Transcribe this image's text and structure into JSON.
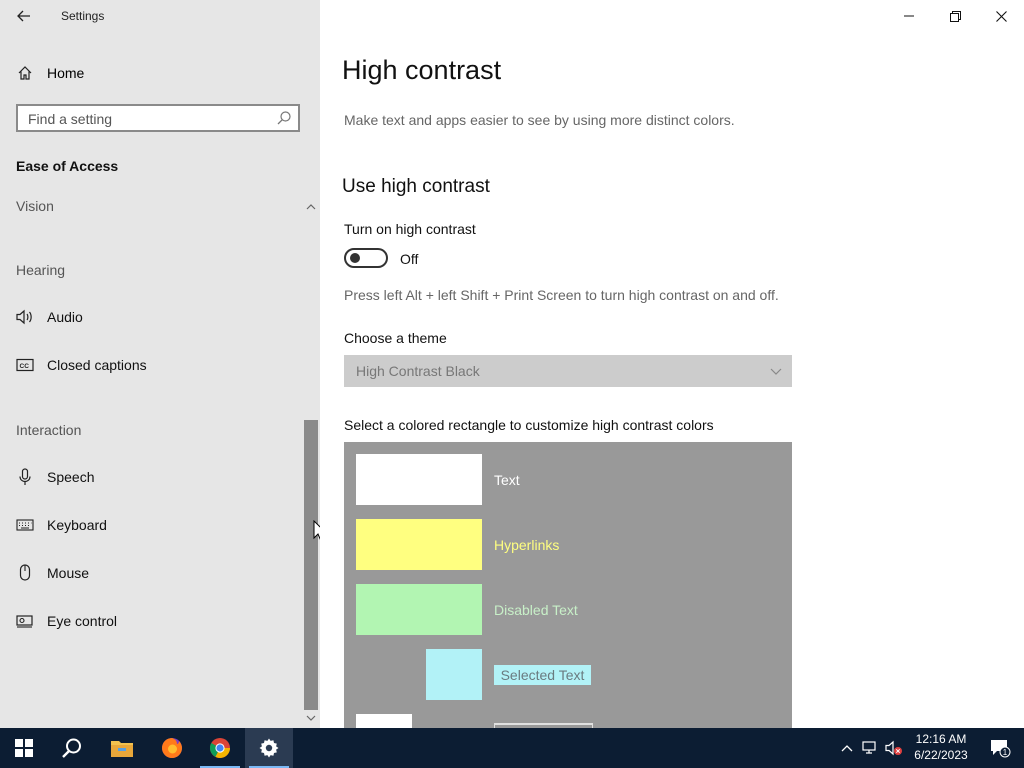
{
  "window": {
    "title": "Settings"
  },
  "sidebar": {
    "home_label": "Home",
    "search_placeholder": "Find a setting",
    "section_title": "Ease of Access",
    "groups": {
      "vision": "Vision",
      "hearing": "Hearing",
      "interaction": "Interaction"
    },
    "items": [
      {
        "label": "Audio",
        "icon": "speaker-icon"
      },
      {
        "label": "Closed captions",
        "icon": "closed-captions-icon"
      },
      {
        "label": "Speech",
        "icon": "microphone-icon"
      },
      {
        "label": "Keyboard",
        "icon": "keyboard-icon"
      },
      {
        "label": "Mouse",
        "icon": "mouse-icon"
      },
      {
        "label": "Eye control",
        "icon": "eye-control-icon"
      }
    ]
  },
  "main": {
    "title": "High contrast",
    "description": "Make text and apps easier to see by using more distinct colors.",
    "use_heading": "Use high contrast",
    "toggle_label": "Turn on high contrast",
    "toggle_state": "Off",
    "toggle_on": false,
    "shortcut_hint": "Press left Alt + left Shift + Print Screen to turn high contrast on and off.",
    "theme_label": "Choose a theme",
    "theme_value": "High Contrast Black",
    "colors_label": "Select a colored rectangle to customize high contrast colors",
    "palette_bg": "#999999",
    "swatches": [
      {
        "label": "Text",
        "color": "#ffffff",
        "label_color": "#ffffff"
      },
      {
        "label": "Hyperlinks",
        "color": "#ffff80",
        "label_color": "#ffff80"
      },
      {
        "label": "Disabled Text",
        "color": "#b2f5b2",
        "label_color": "#c8f0c8"
      },
      {
        "label": "Selected Text",
        "color": "#b2f2f7",
        "label_color": "#6a7b80"
      }
    ]
  },
  "taskbar": {
    "apps": [
      "windows-start-icon",
      "search-icon",
      "file-explorer-icon",
      "firefox-icon",
      "chrome-icon",
      "settings-gear-icon"
    ],
    "time": "12:16 AM",
    "date": "6/22/2023",
    "notification_count": "1"
  }
}
